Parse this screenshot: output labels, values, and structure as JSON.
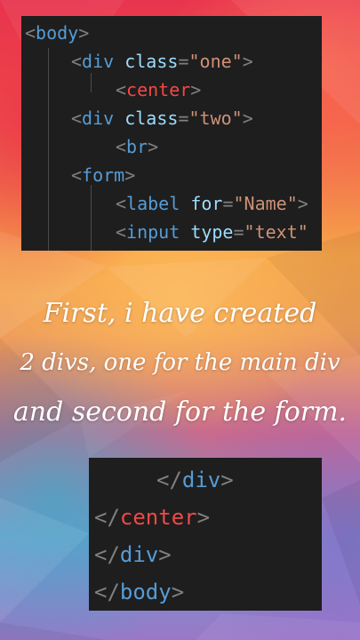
{
  "code_top": {
    "lines": [
      {
        "open": "<",
        "tag": "body",
        "close": ">"
      },
      {
        "open": "<",
        "tag": "div",
        "attr": "class",
        "eq": "=",
        "value": "\"one\"",
        "close": ">"
      },
      {
        "open": "<",
        "tag": "center",
        "close": ">"
      },
      {
        "open": "<",
        "tag": "div",
        "attr": "class",
        "eq": "=",
        "value": "\"two\"",
        "close": ">"
      },
      {
        "open": "<",
        "tag": "br",
        "close": ">"
      },
      {
        "open": "<",
        "tag": "form",
        "close": ">"
      },
      {
        "open": "<",
        "tag": "label",
        "attr": "for",
        "eq": "=",
        "value": "\"Name\"",
        "close": ">"
      },
      {
        "open": "<",
        "tag": "input",
        "attr": "type",
        "eq": "=",
        "value": "\"text\""
      }
    ]
  },
  "caption": {
    "line1": "First, i have created",
    "line2": "2 divs, one for the main div",
    "line3": "and second for the form."
  },
  "code_bottom": {
    "lines": [
      {
        "open": "</",
        "tag": "div",
        "close": ">"
      },
      {
        "open": "</",
        "tag": "center",
        "close": ">"
      },
      {
        "open": "</",
        "tag": "div",
        "close": ">"
      },
      {
        "open": "</",
        "tag": "body",
        "close": ">"
      }
    ]
  },
  "colors": {
    "editor_bg": "#1e1e1e",
    "tag_blue": "#569cd6",
    "tag_red": "#f44747",
    "attr": "#9cdcfe",
    "string": "#ce9178",
    "punct": "#808080"
  }
}
